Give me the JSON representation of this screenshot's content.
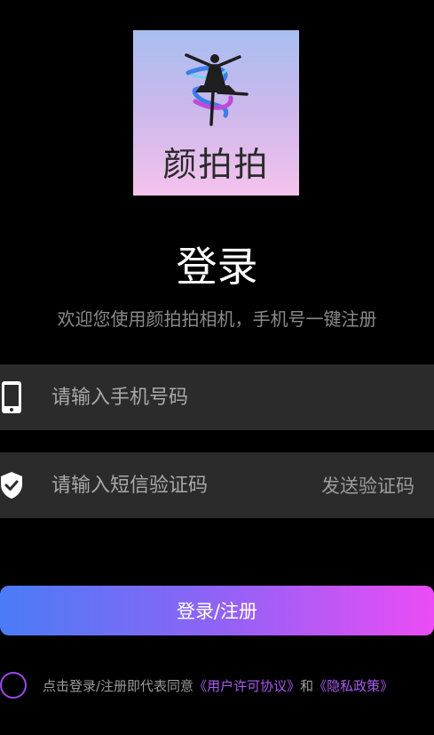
{
  "logo": {
    "text": "颜拍拍"
  },
  "header": {
    "title": "登录",
    "subtitle": "欢迎您使用颜拍拍相机，手机号一键注册"
  },
  "form": {
    "phone_placeholder": "请输入手机号码",
    "code_placeholder": "请输入短信验证码",
    "send_code_label": "发送验证码",
    "submit_label": "登录/注册"
  },
  "agreement": {
    "prefix": "点击登录/注册即代表同意",
    "user_agreement": "《用户许可协议》",
    "conjunction": "和",
    "privacy_policy": "《隐私政策》"
  },
  "icons": {
    "phone": "phone-icon",
    "shield": "shield-check-icon",
    "logo": "dancer-logo-icon"
  },
  "colors": {
    "background": "#000000",
    "input_bg": "#2b2b2b",
    "gradient_start": "#4a7cf7",
    "gradient_end": "#ec4cf5",
    "link": "#a95af0"
  }
}
